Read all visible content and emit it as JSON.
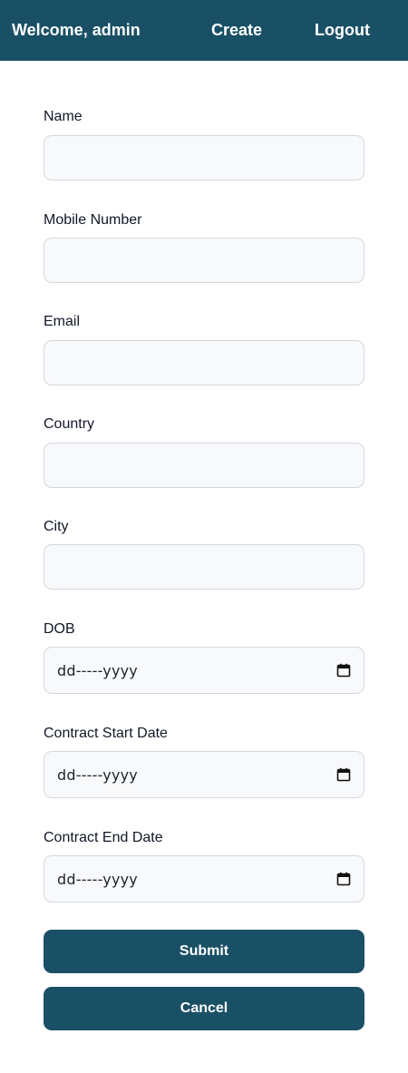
{
  "header": {
    "welcome": "Welcome, admin",
    "nav": {
      "create": "Create",
      "logout": "Logout"
    }
  },
  "form": {
    "fields": [
      {
        "label": "Name",
        "value": "",
        "type": "text"
      },
      {
        "label": "Mobile Number",
        "value": "",
        "type": "text"
      },
      {
        "label": "Email",
        "value": "",
        "type": "text"
      },
      {
        "label": "Country",
        "value": "",
        "type": "text"
      },
      {
        "label": "City",
        "value": "",
        "type": "text"
      },
      {
        "label": "DOB",
        "value": "dd-----yyyy",
        "type": "date"
      },
      {
        "label": "Contract Start Date",
        "value": "dd-----yyyy",
        "type": "date"
      },
      {
        "label": "Contract End Date",
        "value": "dd-----yyyy",
        "type": "date"
      }
    ],
    "submit_label": "Submit",
    "cancel_label": "Cancel"
  },
  "colors": {
    "primary": "#1a5065",
    "input_bg": "#f8f9fb",
    "input_border": "#d4d8de"
  },
  "icons": {
    "date_picker": "calendar-icon"
  }
}
